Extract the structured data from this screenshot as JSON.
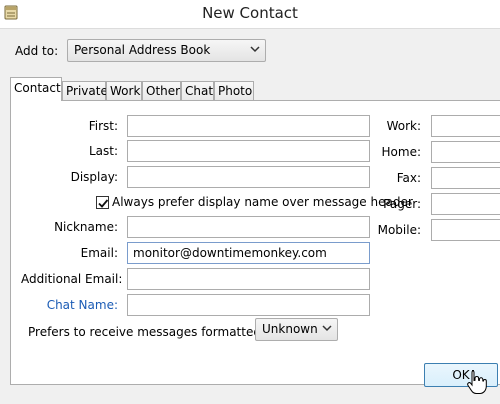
{
  "window": {
    "title": "New Contact",
    "icon": "address-book-icon"
  },
  "addto": {
    "label": "Add to:",
    "selected": "Personal Address Book"
  },
  "tabs": [
    {
      "label": "Contact",
      "active": true
    },
    {
      "label": "Private",
      "active": false
    },
    {
      "label": "Work",
      "active": false
    },
    {
      "label": "Other",
      "active": false
    },
    {
      "label": "Chat",
      "active": false
    },
    {
      "label": "Photo",
      "active": false
    }
  ],
  "contact": {
    "first_label": "First:",
    "first_value": "",
    "last_label": "Last:",
    "last_value": "",
    "display_label": "Display:",
    "display_value": "",
    "prefer_display_label": "Always prefer display name over message header",
    "prefer_display_checked": true,
    "nickname_label": "Nickname:",
    "nickname_value": "",
    "email_label": "Email:",
    "email_value": "monitor@downtimemonkey.com",
    "additional_email_label": "Additional Email:",
    "additional_email_value": "",
    "chat_name_label": "Chat Name:",
    "chat_name_value": "",
    "format_label": "Prefers to receive messages formatted as:",
    "format_selected": "Unknown"
  },
  "phones": {
    "work_label": "Work:",
    "home_label": "Home:",
    "fax_label": "Fax:",
    "pager_label": "Pager:",
    "mobile_label": "Mobile:"
  },
  "buttons": {
    "ok_label": "OK"
  },
  "colors": {
    "link": "#1a5bb5",
    "ok_border": "#3c7fb1"
  }
}
